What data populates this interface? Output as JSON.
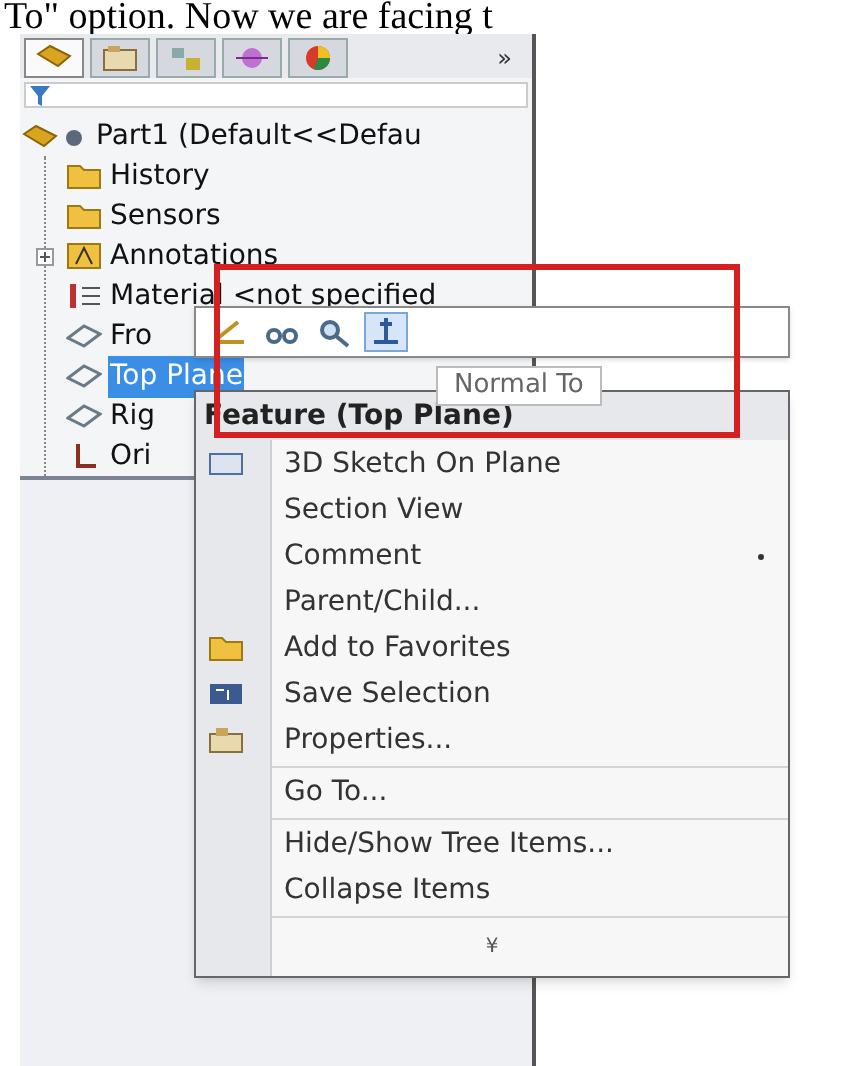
{
  "caption": "To\" option. Now we are facing t",
  "tabs": [
    {
      "kind": "parts",
      "selected": true
    },
    {
      "kind": "properties",
      "selected": false
    },
    {
      "kind": "config",
      "selected": false
    },
    {
      "kind": "dimension",
      "selected": false
    },
    {
      "kind": "display",
      "selected": false
    }
  ],
  "more_tabs": "»",
  "tree": {
    "label": "Part1  (Default<<Defau",
    "children": [
      {
        "label": "History",
        "kind": "folder",
        "selected": false
      },
      {
        "label": "Sensors",
        "kind": "folder",
        "selected": false
      },
      {
        "label": "Annotations",
        "kind": "annotation",
        "selected": false,
        "expanded": false
      },
      {
        "label": "Material <not specified",
        "kind": "material",
        "selected": false
      },
      {
        "label": "Fro",
        "kind": "plane",
        "selected": false
      },
      {
        "label": "Top Plane",
        "kind": "plane",
        "selected": true
      },
      {
        "label": "Rig",
        "kind": "plane",
        "selected": false
      },
      {
        "label": "Ori",
        "kind": "origin",
        "selected": false
      }
    ]
  },
  "toolbar": [
    {
      "kind": "sketch",
      "selected": false
    },
    {
      "kind": "hide",
      "selected": false
    },
    {
      "kind": "zoom",
      "selected": false
    },
    {
      "kind": "normal",
      "selected": true
    }
  ],
  "tooltip": "Normal To",
  "menu": {
    "title": "Feature (Top Plane)",
    "groups": [
      [
        {
          "label": "3D Sketch On Plane",
          "kind": "sketch",
          "submenu": false
        },
        {
          "label": "Section View",
          "kind": "plain",
          "submenu": false
        },
        {
          "label": "Comment",
          "kind": "plain",
          "submenu": true
        },
        {
          "label": "Parent/Child...",
          "kind": "plain",
          "submenu": false
        },
        {
          "label": "Add to Favorites",
          "kind": "folder",
          "submenu": false
        },
        {
          "label": "Save Selection",
          "kind": "selection",
          "submenu": false
        },
        {
          "label": "Properties...",
          "kind": "properties",
          "submenu": false
        }
      ],
      [
        {
          "label": "Go To...",
          "kind": "plain",
          "submenu": false
        }
      ],
      [
        {
          "label": "Hide/Show Tree Items...",
          "kind": "plain",
          "submenu": false
        },
        {
          "label": "Collapse Items",
          "kind": "plain",
          "submenu": false
        }
      ]
    ],
    "expand": "¥"
  }
}
